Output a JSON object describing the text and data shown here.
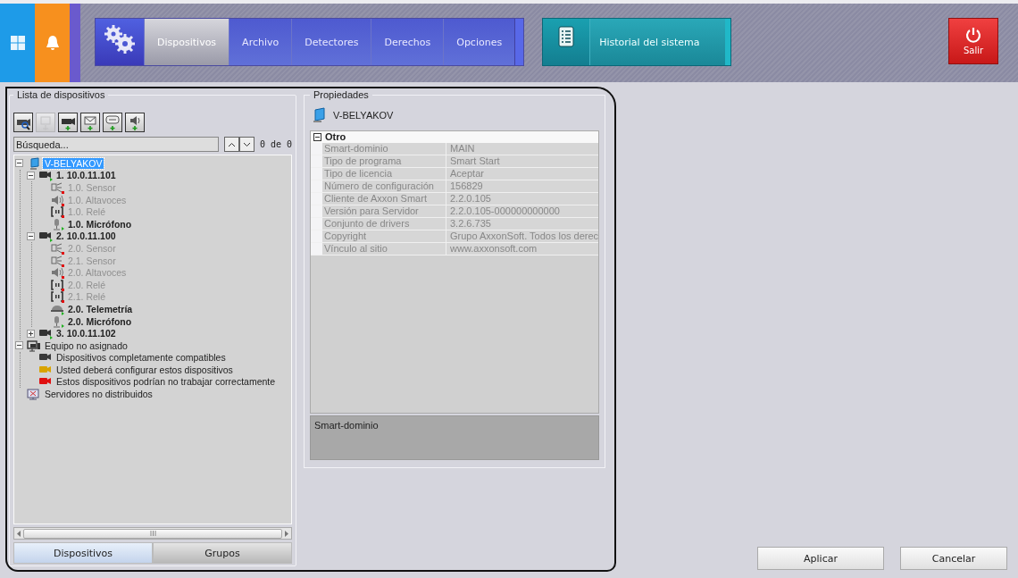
{
  "topbar": {
    "tiles": [
      {
        "kind": "windows",
        "color": "#1e9be8"
      },
      {
        "kind": "bell",
        "color": "#f7901e"
      }
    ],
    "menu": [
      {
        "label": "Dispositivos",
        "selected": true
      },
      {
        "label": "Archivo",
        "selected": false
      },
      {
        "label": "Detectores",
        "selected": false
      },
      {
        "label": "Derechos",
        "selected": false
      },
      {
        "label": "Opciones",
        "selected": false
      }
    ],
    "history": {
      "label": "Historial del sistema"
    },
    "exit": {
      "label": "Salir"
    }
  },
  "devices": {
    "title": "Lista de dispositivos",
    "toolbar": [
      {
        "kind": "camera-search",
        "disabled": false
      },
      {
        "kind": "monitor-add",
        "disabled": true
      },
      {
        "kind": "camera-add",
        "disabled": false
      },
      {
        "kind": "mail-add",
        "disabled": false
      },
      {
        "kind": "sms-add",
        "disabled": false
      },
      {
        "kind": "speaker-add",
        "disabled": false
      }
    ],
    "search": {
      "placeholder": "Búsqueda...",
      "count": "0 de 0"
    },
    "tree": [
      {
        "label": "V-BELYAKOV",
        "kind": "server",
        "selected": true,
        "expanded": true,
        "children": [
          {
            "label": "1. 10.0.11.101",
            "kind": "camera",
            "bold": true,
            "disabled": false,
            "selected": false,
            "expanded": true,
            "children": [
              {
                "label": "1.0. Sensor",
                "kind": "sensor",
                "disabled": true,
                "selected": false
              },
              {
                "label": "1.0. Altavoces",
                "kind": "speaker",
                "disabled": true,
                "selected": false
              },
              {
                "label": "1.0. Relé",
                "kind": "relay",
                "disabled": true,
                "selected": false
              },
              {
                "label": "1.0. Micrófono",
                "kind": "microphone",
                "bold": true,
                "disabled": false,
                "selected": false
              }
            ]
          },
          {
            "label": "2. 10.0.11.100",
            "kind": "camera",
            "bold": true,
            "disabled": false,
            "selected": false,
            "expanded": true,
            "children": [
              {
                "label": "2.0. Sensor",
                "kind": "sensor",
                "disabled": true,
                "selected": false
              },
              {
                "label": "2.1. Sensor",
                "kind": "sensor",
                "disabled": true,
                "selected": false
              },
              {
                "label": "2.0. Altavoces",
                "kind": "speaker",
                "disabled": true,
                "selected": false
              },
              {
                "label": "2.0. Relé",
                "kind": "relay",
                "disabled": true,
                "selected": false
              },
              {
                "label": "2.1. Relé",
                "kind": "relay",
                "disabled": true,
                "selected": false
              },
              {
                "label": "2.0. Telemetría",
                "kind": "telemetry",
                "bold": true,
                "disabled": false,
                "selected": false
              },
              {
                "label": "2.0. Micrófono",
                "kind": "microphone",
                "bold": true,
                "disabled": false,
                "selected": false
              }
            ]
          },
          {
            "label": "3. 10.0.11.102",
            "kind": "camera",
            "bold": true,
            "disabled": false,
            "selected": false,
            "expanded": false
          }
        ]
      },
      {
        "label": "Equipo no asignado",
        "kind": "group",
        "selected": false,
        "expanded": true,
        "children": [
          {
            "label": "Dispositivos completamente compatibles",
            "kind": "legend",
            "color": "#3a3a3a",
            "selected": false
          },
          {
            "label": "Usted deberá configurar estos dispositivos",
            "kind": "legend",
            "color": "#d9a400",
            "selected": false
          },
          {
            "label": "Estos dispositivos podrían no trabajar correctamente",
            "kind": "legend",
            "color": "#e01010",
            "selected": false
          }
        ]
      },
      {
        "label": "Servidores no distribuidos",
        "kind": "monitor",
        "selected": false
      }
    ],
    "tabs": [
      {
        "label": "Dispositivos",
        "selected": true
      },
      {
        "label": "Grupos",
        "selected": false
      }
    ]
  },
  "properties": {
    "title": "Propiedades",
    "object": "V-BELYAKOV",
    "section": {
      "label": "Otro",
      "expanded": true
    },
    "rows": [
      {
        "name": "Smart-dominio",
        "value": "MAIN"
      },
      {
        "name": "Tipo de programa",
        "value": "Smart Start"
      },
      {
        "name": "Tipo de licencia",
        "value": "Aceptar"
      },
      {
        "name": "Número de configuración",
        "value": "156829"
      },
      {
        "name": "Cliente de Axxon Smart",
        "value": "2.2.0.105"
      },
      {
        "name": "Versión para Servidor",
        "value": "2.2.0.105-000000000000"
      },
      {
        "name": "Conjunto de drivers",
        "value": "3.2.6.735"
      },
      {
        "name": "Copyright",
        "value": "Grupo AxxonSoft. Todos los derec"
      },
      {
        "name": "Vínculo al sitio",
        "value": "www.axxonsoft.com"
      }
    ],
    "description": "Smart-dominio"
  },
  "buttons": [
    "Aplicar",
    "Cancelar"
  ]
}
